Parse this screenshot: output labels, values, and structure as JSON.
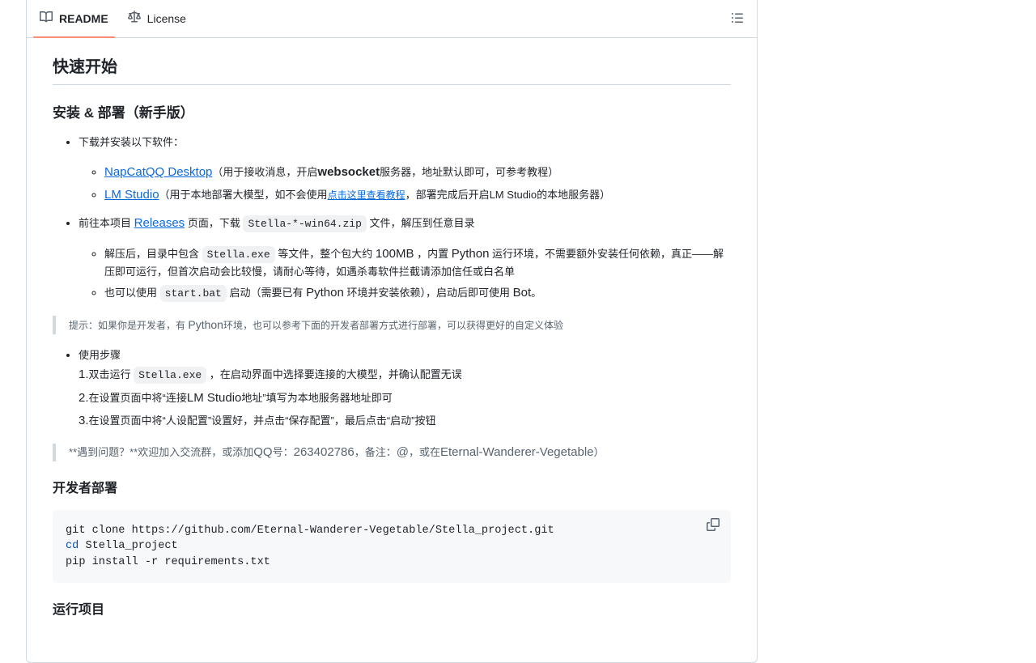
{
  "tabs": {
    "readme_label": "README",
    "license_label": "License",
    "readme_icon": "book-icon",
    "license_icon": "law-icon",
    "outline_icon": "list-unordered-icon"
  },
  "readme": {
    "h2_glyph": "",
    "h2_text": "快速开始",
    "h3_glyph": "",
    "h3_text": "安装 & 部署（新手版）",
    "item1": "下载并安装以下软件：",
    "napcat_link": "NapCatQQ Desktop",
    "napcat_mid": "（用于接收消息，开启",
    "napcat_bold": "websocket",
    "napcat_tail": "服务器，地址默认即可，可参考教程）",
    "lmstudio_link": "LM Studio",
    "lmstudio_mid": "（用于本地部署大模型，如不会使用",
    "lmstudio_link2": "点击这里查看教程",
    "lmstudio_tail": "，部署完成后开启LM Studio的本地服务器）",
    "item2_pre": "前往本项目",
    "releases_link": "Releases",
    "item2_mid": "页面，下载",
    "item2_code": "Stella-*-win64.zip",
    "item2_tail": "文件，解压到任意目录",
    "sub2a_pre": "解压后，目录中包含",
    "sub2a_code": "Stella.exe",
    "sub2a_mid": "等文件，整个包大约",
    "sub2a_size": "100MB",
    "sub2a_mid2": "，内置",
    "sub2a_python": "Python",
    "sub2a_tail": "运行环境，不需要额外安装任何依赖，真正——解压即可运行，但首次启动会比较慢，请耐心等待，如遇杀毒软件拦截请添加信任或",
    "sub2a_tail2": "白名单",
    "sub2b_pre": "也可以使用",
    "sub2b_code": "start.bat",
    "sub2b_mid": "启动（需要已有",
    "sub2b_python": "Python",
    "sub2b_mid2": "环境并安装依赖），启动后即可使用",
    "sub2b_bot": "Bot",
    "sub2b_end": "。",
    "quote1_pre": "提示：如果你是开发者，有",
    "quote1_python": "Python",
    "quote1_tail": "环境，也可以参考下面的开发者部署方式进行部署，可以获得更好的自定义体验",
    "item3": "使用步骤",
    "step1_num": "1.",
    "step1_pre": "双击运行",
    "step1_code": "Stella.exe",
    "step1_tail": "，在启动界面中选择要连接的大模型，并确认配置无误",
    "step2_num": "2.",
    "step2_pre": "在设置页面中将“连接",
    "step2_lm": "LM Studio",
    "step2_tail": "地址”填写为本地服务器地址即可",
    "step3_num": "3.",
    "step3_text": "在设置页面中将“人设配置”设置好，并点击“保存配置”，最后点击“启动”按钮",
    "quote2_pre": "**遇到问题？**欢迎加入交流群，或添加",
    "quote2_qq": "QQ",
    "quote2_mid": "号：",
    "quote2_num": "263402786",
    "quote2_mid2": "，备注：",
    "quote2_at": "@",
    "quote2_mid3": "，或在",
    "quote2_gh": "Eternal-Wanderer-Vegetable",
    "quote2_end": "）",
    "h4_dev": "开发者部署",
    "code_line1": "git clone https://github.com/Eternal-Wanderer-Vegetable/Stella_project.git",
    "code_kw": "cd",
    "code_line2_rest": " Stella_project",
    "code_line3": "pip install -r requirements.txt",
    "copy_icon": "copy-icon",
    "h4_run": "运行项目"
  }
}
